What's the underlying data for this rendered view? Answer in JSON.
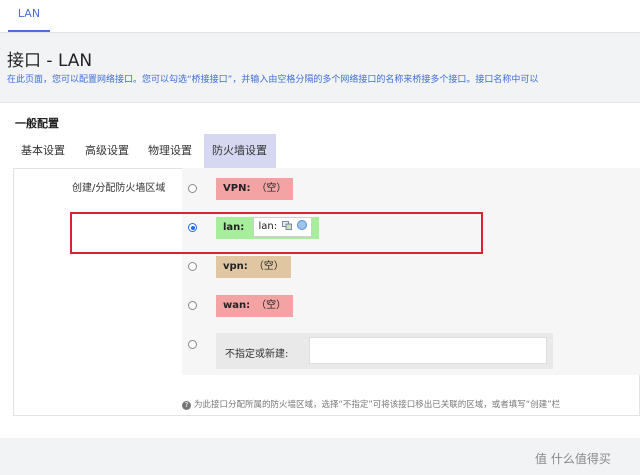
{
  "nav": {
    "tab": "LAN"
  },
  "page": {
    "title": "接口 - LAN",
    "description": "在此页面，您可以配置网络接口。您可以勾选“桥接接口”，并输入由空格分隔的多个网络接口的名称来桥接多个接口。接口名称中可以"
  },
  "section": {
    "title": "一般配置"
  },
  "tabs": [
    {
      "label": "基本设置",
      "active": false
    },
    {
      "label": "高级设置",
      "active": false
    },
    {
      "label": "物理设置",
      "active": false
    },
    {
      "label": "防火墙设置",
      "active": true
    }
  ],
  "firewall": {
    "field_label": "创建/分配防火墙区域",
    "zones": [
      {
        "name": "VPN:",
        "value": "（空）",
        "color": "#f3a3a3",
        "checked": false
      },
      {
        "name": "lan:",
        "interface": "lan:",
        "color": "#a6ee9c",
        "checked": true,
        "icons": [
          "network-icon",
          "globe-icon"
        ]
      },
      {
        "name": "vpn:",
        "value": "（空）",
        "color": "#e1c6a2",
        "checked": false
      },
      {
        "name": "wan:",
        "value": "（空）",
        "color": "#f3a3a3",
        "checked": false
      }
    ],
    "new_zone": {
      "label": "不指定或新建:",
      "value": ""
    },
    "help": "为此接口分配所属的防火墙区域，选择“不指定”可将该接口移出已关联的区域，或者填写“创建”栏"
  },
  "watermark": "值 什么值得买"
}
